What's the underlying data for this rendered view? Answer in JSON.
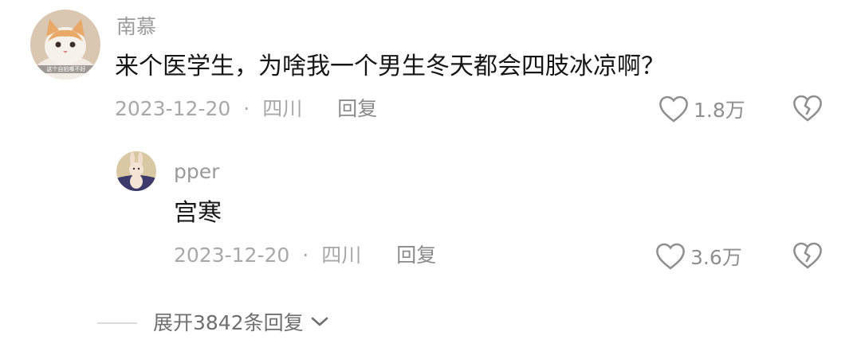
{
  "comment": {
    "username": "南慕",
    "text": "来个医学生，为啥我一个男生冬天都会四肢冰凉啊？",
    "date": "2023-12-20",
    "separator": "·",
    "location": "四川",
    "reply_label": "回复",
    "like_count": "1.8万",
    "avatar_caption": "这个自拍哪不好"
  },
  "reply": {
    "username": "pper",
    "text": "宫寒",
    "date": "2023-12-20",
    "separator": "·",
    "location": "四川",
    "reply_label": "回复",
    "like_count": "3.6万"
  },
  "expand": {
    "label": "展开3842条回复"
  },
  "colors": {
    "text": "#161616",
    "username": "#9a9a9a",
    "meta": "#a8a8a8",
    "icon": "#8f8f8f"
  }
}
